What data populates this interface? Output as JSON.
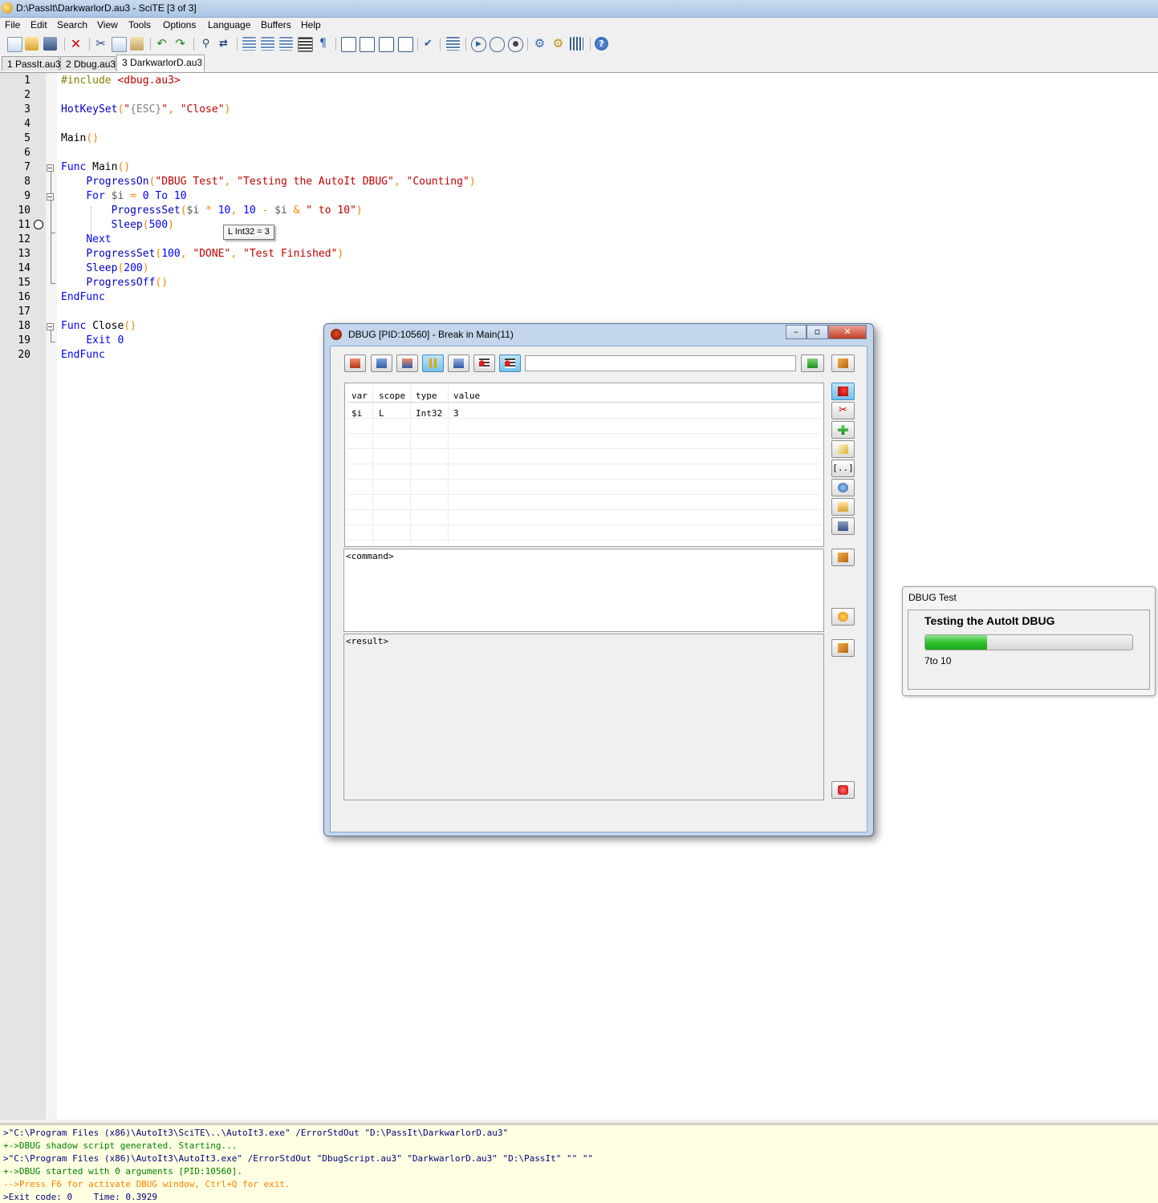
{
  "window": {
    "title": "D:\\PassIt\\DarkwarlorD.au3 - SciTE [3 of 3]"
  },
  "menu": [
    "File",
    "Edit",
    "Search",
    "View",
    "Tools",
    "Options",
    "Language",
    "Buffers",
    "Help"
  ],
  "toolbar": {
    "icons": [
      "new-icon",
      "open-icon",
      "save-icon",
      "close-icon",
      "cut-icon",
      "copy-icon",
      "paste-icon",
      "undo-icon",
      "redo-icon",
      "find-icon",
      "replace-icon",
      "indent-icon",
      "outdent-icon",
      "block-icon",
      "wrap-icon",
      "whitespace-icon",
      "view1-icon",
      "view2-icon",
      "view3-icon",
      "view4-icon",
      "spell-icon",
      "output-icon",
      "run-icon",
      "compile-icon",
      "stop-icon",
      "tools1-icon",
      "tools2-icon",
      "tools3-icon",
      "help-icon"
    ]
  },
  "tabs": [
    {
      "label": "1 PassIt.au3"
    },
    {
      "label": "2 Dbug.au3"
    },
    {
      "label": "3 DarkwarlorD.au3"
    }
  ],
  "editor": {
    "line_numbers": [
      "1",
      "2",
      "3",
      "4",
      "5",
      "6",
      "7",
      "8",
      "9",
      "10",
      "11",
      "12",
      "13",
      "14",
      "15",
      "16",
      "17",
      "18",
      "19",
      "20"
    ],
    "tooltip": "L Int32 = 3"
  },
  "output": {
    "lines": [
      ">\"C:\\Program Files (x86)\\AutoIt3\\SciTE\\..\\AutoIt3.exe\" /ErrorStdOut \"D:\\PassIt\\DarkwarlorD.au3\"",
      "+->DBUG shadow script generated. Starting...",
      ">\"C:\\Program Files (x86)\\AutoIt3\\AutoIt3.exe\" /ErrorStdOut \"DbugScript.au3\" \"DarkwarlorD.au3\" \"D:\\PassIt\" \"\" \"\"",
      "+->DBUG started with 0 arguments [PID:10560].",
      "-->Press F6 for activate DBUG window, Ctrl+Q for exit.",
      ">Exit code: 0    Time: 0.3929"
    ],
    "colors": [
      "#000080",
      "#008000",
      "#000080",
      "#008000",
      "#ff8000",
      "#000080"
    ]
  },
  "dbug": {
    "title": "DBUG [PID:10560] - Break in Main(11)",
    "command_input": "",
    "columns": [
      "var",
      "scope",
      "type",
      "value"
    ],
    "rows": [
      {
        "var": "$i",
        "scope": "L",
        "type": "Int32",
        "value": "3"
      }
    ],
    "command_text": "<command>",
    "result_text": "<result>",
    "side_bracket": "[..]"
  },
  "progress": {
    "title": "DBUG Test",
    "main_text": "Testing the AutoIt DBUG",
    "sub_text": "7to 10",
    "percent": 30
  }
}
